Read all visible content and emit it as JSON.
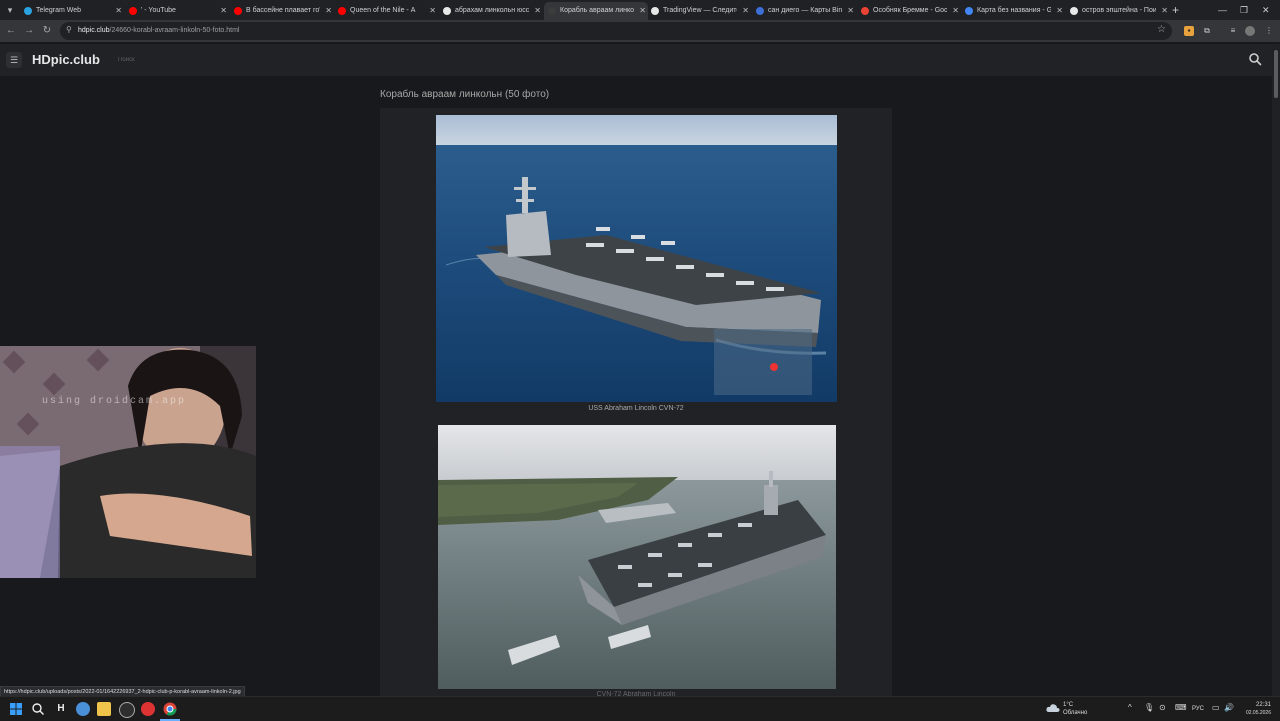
{
  "browser": {
    "tabs": [
      {
        "title": "Telegram Web",
        "favicon_color": "#2aa3e0"
      },
      {
        "title": "' - YouTube",
        "favicon_color": "#ff0000"
      },
      {
        "title": "В бассейне плавает го'н",
        "favicon_color": "#ff0000"
      },
      {
        "title": "Queen of the Nile - А",
        "favicon_color": "#ff0000"
      },
      {
        "title": "абрахам линкольн юсс -",
        "favicon_color": "#e8e8e8"
      },
      {
        "title": "Корабль авраам линкол",
        "favicon_color": "#3c3c3c",
        "active": true
      },
      {
        "title": "TradingView — Следите",
        "favicon_color": "#e8e8e8"
      },
      {
        "title": "сан диего — Карты Bing",
        "favicon_color": "#3c6fd8"
      },
      {
        "title": "Особняк Бремме - Goog",
        "favicon_color": "#ea4335"
      },
      {
        "title": "Карта без названия - Go",
        "favicon_color": "#4285f4"
      },
      {
        "title": "остров эпштейна - Пои",
        "favicon_color": "#e8e8e8"
      }
    ],
    "url_host": "hdpic.club",
    "url_path": "/24660-korabl-avraam-linkoln-50-foto.html"
  },
  "site": {
    "logo": "HDpic.club",
    "search_placeholder": "Поиск"
  },
  "page": {
    "title": "Корабль авраам линкольн (50 фото)",
    "photos": [
      {
        "caption": "USS Abraham Lincoln CVN-72"
      },
      {
        "caption": "CVN-72 Abraham Lincoln"
      }
    ]
  },
  "webcam": {
    "watermark": "using droidcam.app"
  },
  "status_url": "https://hdpic.club/uploads/posts/2022-01/1642226937_2-hdpic-club-p-korabl-avraam-linkoln-2.jpg",
  "taskbar": {
    "weather_temp": "1°C",
    "weather_desc": "Облачно",
    "lang": "РУС",
    "time": "22:31",
    "date": "02.05.2026"
  },
  "colors": {
    "background": "#18191c",
    "header": "#202226",
    "sea": "#1d4a78",
    "sky": "#b8c6d6"
  }
}
